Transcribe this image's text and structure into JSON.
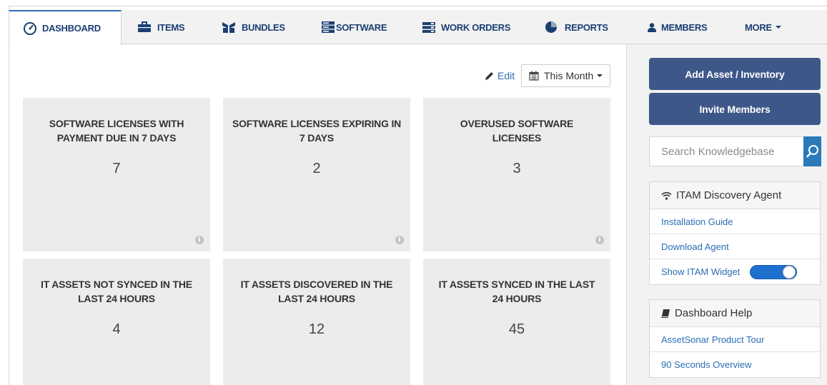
{
  "nav": {
    "tabs": [
      {
        "label": "DASHBOARD",
        "icon": "dashboard-gauge-icon"
      },
      {
        "label": "ITEMS",
        "icon": "briefcase-icon"
      },
      {
        "label": "BUNDLES",
        "icon": "bundle-icon"
      },
      {
        "label": "SOFTWARE",
        "icon": "server-icon"
      },
      {
        "label": "WORK ORDERS",
        "icon": "work-orders-icon"
      },
      {
        "label": "REPORTS",
        "icon": "pie-chart-icon"
      },
      {
        "label": "MEMBERS",
        "icon": "user-icon"
      },
      {
        "label": "MORE",
        "icon": "chevron-down-icon"
      }
    ]
  },
  "toolbar": {
    "edit_label": "Edit",
    "period_label": "This Month"
  },
  "cards": [
    {
      "title": "SOFTWARE LICENSES WITH PAYMENT DUE IN 7 DAYS",
      "value": "7"
    },
    {
      "title": "SOFTWARE LICENSES EXPIRING IN 7 DAYS",
      "value": "2"
    },
    {
      "title": "OVERUSED SOFTWARE LICENSES",
      "value": "3"
    },
    {
      "title": "IT ASSETS NOT SYNCED IN THE LAST 24 HOURS",
      "value": "4"
    },
    {
      "title": "IT ASSETS DISCOVERED IN THE LAST 24 HOURS",
      "value": "12"
    },
    {
      "title": "IT ASSETS SYNCED IN THE LAST 24 HOURS",
      "value": "45"
    }
  ],
  "sidebar": {
    "add_asset_label": "Add Asset / Inventory",
    "invite_label": "Invite Members",
    "search_placeholder": "Search Knowledgebase",
    "discovery": {
      "title": "ITAM Discovery Agent",
      "links": [
        "Installation Guide",
        "Download Agent"
      ],
      "widget_label": "Show ITAM Widget",
      "widget_on": true
    },
    "help": {
      "title": "Dashboard Help",
      "links": [
        "AssetSonar Product Tour",
        "90 Seconds Overview"
      ]
    }
  },
  "colors": {
    "nav_text": "#1b3f73",
    "link": "#2a6fb5",
    "primary_button": "#3e5789",
    "search_button": "#2a7ab9",
    "card_bg": "#ececec",
    "toggle_on": "#1f6fce"
  }
}
